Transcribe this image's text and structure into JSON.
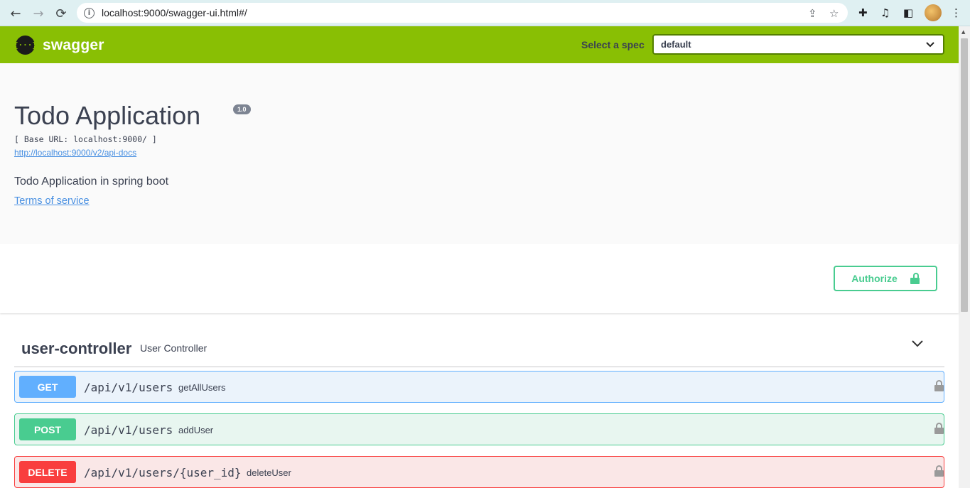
{
  "browser": {
    "url": "localhost:9000/swagger-ui.html#/",
    "back_icon": "arrow-left",
    "forward_icon": "arrow-right",
    "reload_icon": "reload"
  },
  "topbar": {
    "logo_text": "swagger",
    "logo_glyph": "{···}",
    "spec_label": "Select a spec",
    "spec_value": "default"
  },
  "info": {
    "title": "Todo Application",
    "version": "1.0",
    "base_url": "[ Base URL: localhost:9000/ ]",
    "api_docs_link": "http://localhost:9000/v2/api-docs",
    "description": "Todo Application in spring boot",
    "terms_link": "Terms of service"
  },
  "scheme": {
    "authorize_label": "Authorize"
  },
  "tag": {
    "name": "user-controller",
    "description": "User Controller"
  },
  "operations": [
    {
      "method": "GET",
      "path": "/api/v1/users",
      "summary": "getAllUsers"
    },
    {
      "method": "POST",
      "path": "/api/v1/users",
      "summary": "addUser"
    },
    {
      "method": "DELETE",
      "path": "/api/v1/users/{user_id}",
      "summary": "deleteUser"
    }
  ],
  "colors": {
    "topbar": "#89bf04",
    "get": "#61affe",
    "post": "#49cc90",
    "delete": "#f93e3e"
  }
}
